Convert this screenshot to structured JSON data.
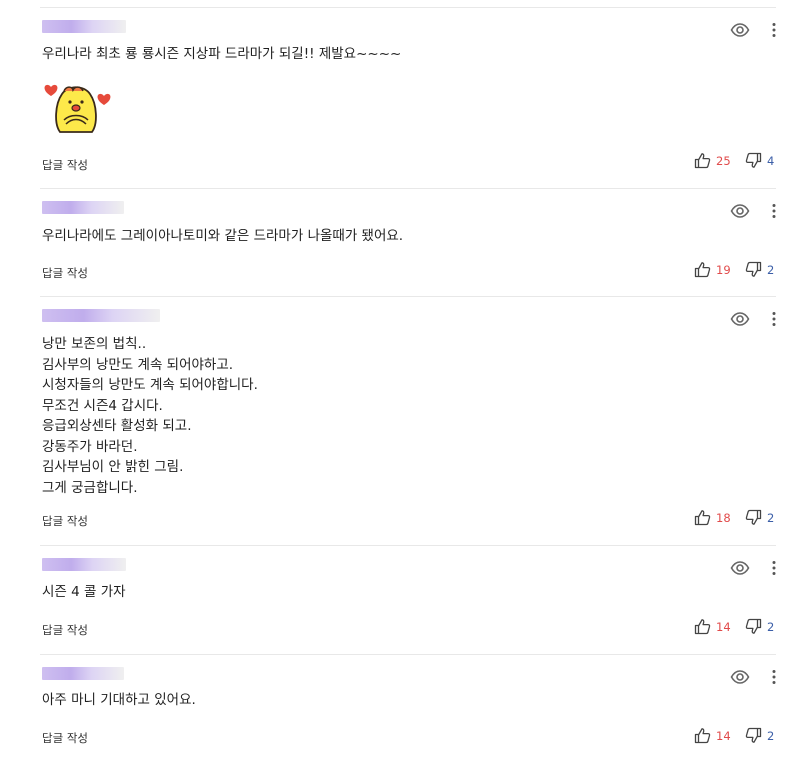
{
  "comments": [
    {
      "text": "우리나라 최초 룡 룡시즌 지상파 드라마가 되길!! 제발요~~~~",
      "reply_label": "답글 작성",
      "likes": "25",
      "dislikes": "4",
      "has_sticker": true
    },
    {
      "text": "우리나라에도 그레이아나토미와 같은 드라마가 나올때가 됐어요.",
      "reply_label": "답글 작성",
      "likes": "19",
      "dislikes": "2",
      "has_sticker": false
    },
    {
      "text": "낭만 보존의  법칙..\n김사부의  낭만도  계속  되어야하고.\n시청자들의  낭만도  계속  되어야합니다.\n무조건  시즌4   갑시다.\n응급외상센타  활성화 되고.\n강동주가  바라던.\n김사부님이   안 밝힌  그림.\n그게  궁금합니다.",
      "reply_label": "답글 작성",
      "likes": "18",
      "dislikes": "2",
      "has_sticker": false
    },
    {
      "text": "시즌 4 콜 가자",
      "reply_label": "답글 작성",
      "likes": "14",
      "dislikes": "2",
      "has_sticker": false
    },
    {
      "text": "아주 마니 기대하고 있어요.",
      "reply_label": "답글 작성",
      "likes": "14",
      "dislikes": "2",
      "has_sticker": false
    }
  ],
  "colors": {
    "like": "#e14b4b",
    "dislike": "#3c5fa8",
    "username_blur": "#b9a4ea"
  },
  "icons": {
    "view": "eye-icon",
    "menu": "more-vertical-icon",
    "like": "thumbs-up-icon",
    "dislike": "thumbs-down-icon"
  }
}
